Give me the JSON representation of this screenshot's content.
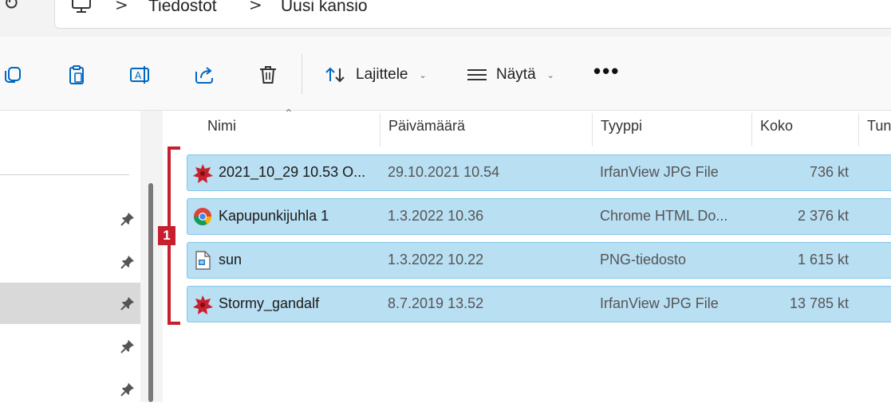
{
  "address_bar": {
    "crumbs": [
      "Tiedostot",
      "Uusi kansio"
    ],
    "separator": ">"
  },
  "toolbar": {
    "icons": [
      "copy-icon",
      "paste-icon",
      "rename-icon",
      "share-icon",
      "delete-icon"
    ],
    "sort_label": "Lajittele",
    "view_label": "Näytä",
    "more_label": "•••"
  },
  "columns": [
    "Nimi",
    "Päivämäärä",
    "Tyyppi",
    "Koko",
    "Tun"
  ],
  "files": [
    {
      "name": "2021_10_29 10.53 O...",
      "date": "29.10.2021 10.54",
      "type": "IrfanView JPG File",
      "size": "736 kt",
      "icon": "irfanview-icon"
    },
    {
      "name": "Kapupunkijuhla 1",
      "date": "1.3.2022 10.36",
      "type": "Chrome HTML Do...",
      "size": "2 376 kt",
      "icon": "chrome-icon"
    },
    {
      "name": "sun",
      "date": "1.3.2022 10.22",
      "type": "PNG-tiedosto",
      "size": "1 615 kt",
      "icon": "png-file-icon"
    },
    {
      "name": "Stormy_gandalf",
      "date": "8.7.2019 13.52",
      "type": "IrfanView JPG File",
      "size": "13 785 kt",
      "icon": "irfanview-icon"
    }
  ],
  "annotation": {
    "label": "1",
    "color": "#c6202f"
  },
  "colors": {
    "selection": "#b9dff3",
    "selection_border": "#86c4e8",
    "accent": "#0067c0"
  }
}
